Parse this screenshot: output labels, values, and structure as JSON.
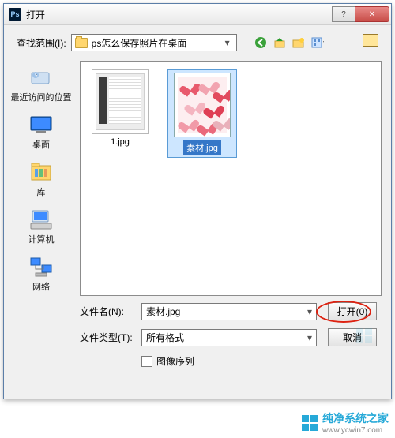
{
  "window": {
    "title": "打开",
    "app_icon_text": "Ps"
  },
  "lookin": {
    "label": "查找范围(I):",
    "value": "ps怎么保存照片在桌面"
  },
  "places": [
    {
      "id": "recent",
      "label": "最近访问的位置"
    },
    {
      "id": "desktop",
      "label": "桌面"
    },
    {
      "id": "libraries",
      "label": "库"
    },
    {
      "id": "computer",
      "label": "计算机"
    },
    {
      "id": "network",
      "label": "网络"
    }
  ],
  "files": [
    {
      "name": "1.jpg",
      "selected": false,
      "kind": "psd-ui"
    },
    {
      "name": "素材.jpg",
      "selected": true,
      "kind": "hearts"
    }
  ],
  "filename": {
    "label": "文件名(N):",
    "value": "素材.jpg"
  },
  "filetype": {
    "label": "文件类型(T):",
    "value": "所有格式"
  },
  "buttons": {
    "open": "打开(0)",
    "cancel": "取消"
  },
  "sequence_checkbox": {
    "label": "图像序列",
    "checked": false
  },
  "brand": {
    "name": "纯净系统之家",
    "url": "www.ycwin7.com"
  }
}
